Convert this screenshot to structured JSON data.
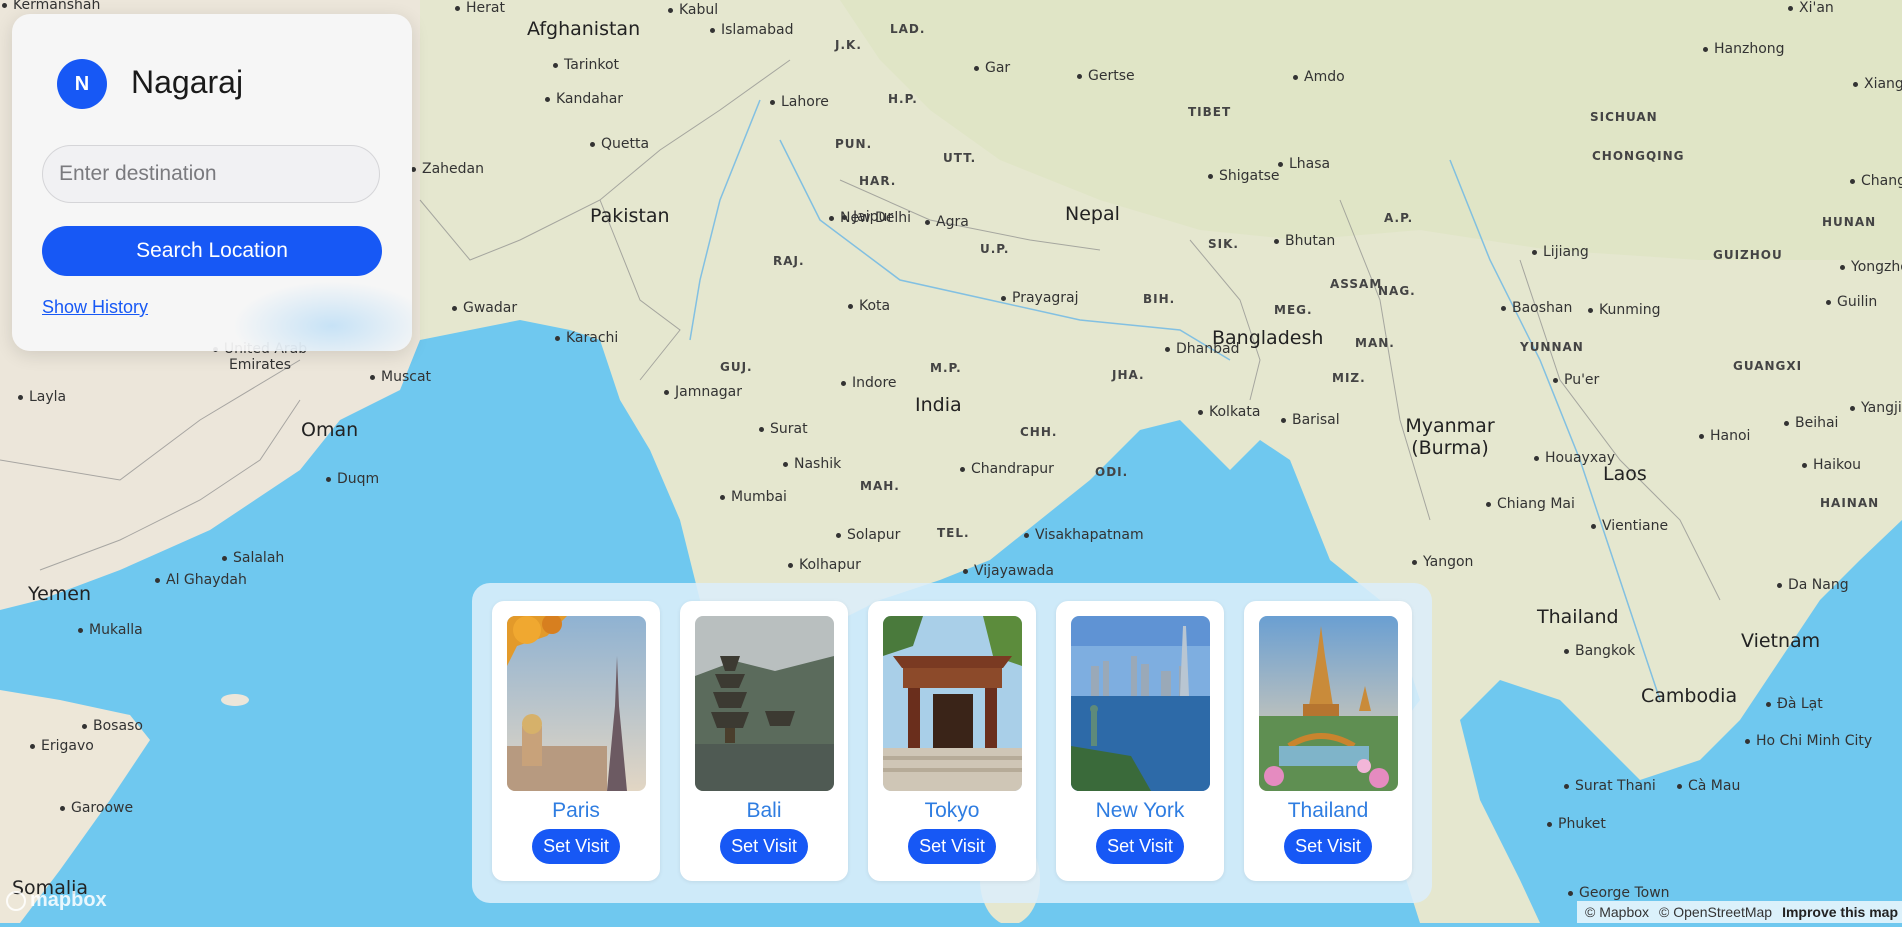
{
  "user": {
    "initial": "N",
    "name": "Nagaraj"
  },
  "search": {
    "placeholder": "Enter destination",
    "button_label": "Search Location",
    "history_link": "Show History"
  },
  "destinations": [
    {
      "name": "Paris",
      "button": "Set Visit"
    },
    {
      "name": "Bali",
      "button": "Set Visit"
    },
    {
      "name": "Tokyo",
      "button": "Set Visit"
    },
    {
      "name": "New York",
      "button": "Set Visit"
    },
    {
      "name": "Thailand",
      "button": "Set Visit"
    }
  ],
  "map": {
    "countries": [
      "Afghanistan",
      "Pakistan",
      "Nepal",
      "India",
      "Bangladesh",
      "Bhutan",
      "Oman",
      "Yemen",
      "Myanmar (Burma)",
      "Laos",
      "Thailand",
      "Vietnam",
      "Cambodia",
      "Somalia",
      "United Arab Emirates"
    ],
    "regions": [
      "TIBET",
      "SICHUAN",
      "CHONGQING",
      "HUNAN",
      "GUIZHOU",
      "YUNNAN",
      "GUANGXI",
      "HAINAN",
      "A.P.",
      "ASSAM",
      "NAG.",
      "MEG.",
      "MAN.",
      "MIZ.",
      "SIK.",
      "J.K.",
      "LAD.",
      "H.P.",
      "PUN.",
      "UTT.",
      "HAR.",
      "RAJ.",
      "U.P.",
      "BIH.",
      "GUJ.",
      "M.P.",
      "JHA.",
      "CHH.",
      "ODI.",
      "MAH.",
      "TEL."
    ],
    "cities": [
      "Kermanshah",
      "Herat",
      "Kabul",
      "Islamabad",
      "Tarinkot",
      "Kandahar",
      "Lahore",
      "Quetta",
      "Zahedan",
      "Gar",
      "Gertse",
      "Amdo",
      "Shigatse",
      "Lhasa",
      "New Delhi",
      "Agra",
      "Jaipur",
      "Prayagraj",
      "Kota",
      "Gwadar",
      "Karachi",
      "Dhanbad",
      "Kolkata",
      "Barisal",
      "Jamnagar",
      "Indore",
      "Surat",
      "Nashik",
      "Chandrapur",
      "Mumbai",
      "Solapur",
      "Kolhapur",
      "Vijayawada",
      "Visakhapatnam",
      "Muscat",
      "Layla",
      "Duqm",
      "Salalah",
      "Al Ghaydah",
      "Mukalla",
      "Bosaso",
      "Erigavo",
      "Garoowe",
      "Lijiang",
      "Baoshan",
      "Kunming",
      "Pu'er",
      "Houayxay",
      "Chiang Mai",
      "Vientiane",
      "Hanoi",
      "Haikou",
      "Beihai",
      "Yangon",
      "Bangkok",
      "Da Nang",
      "Đà Lạt",
      "Ho Chi Minh City",
      "Cà Mau",
      "Surat Thani",
      "Phuket",
      "George Town",
      "Hanzhong",
      "Xi'an",
      "Guilin",
      "Yongzhou",
      "Changde",
      "Xiangyang",
      "Yangjiang"
    ],
    "attribution": [
      "© Mapbox",
      "© OpenStreetMap",
      "Improve this map"
    ],
    "logo": "mapbox"
  },
  "colors": {
    "accent": "#1758f5",
    "card_title": "#2f7de1",
    "water": "#6fc8ef",
    "land": "#e9e6d6"
  }
}
